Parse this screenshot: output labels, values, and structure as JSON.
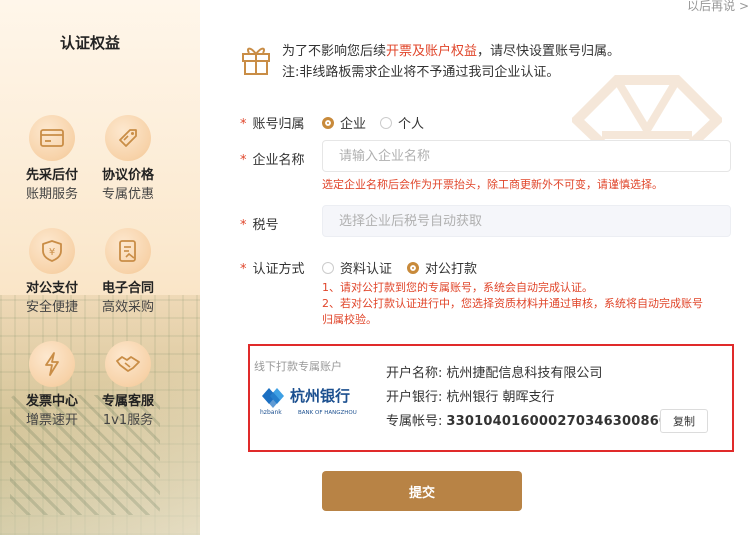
{
  "header": {
    "later_label": "以后再说 >"
  },
  "sidebar": {
    "title": "认证权益",
    "benefits": [
      {
        "title": "先采后付",
        "desc": "账期服务",
        "icon": "card-icon"
      },
      {
        "title": "协议价格",
        "desc": "专属优惠",
        "icon": "tag-icon"
      },
      {
        "title": "对公支付",
        "desc": "安全便捷",
        "icon": "shield-yuan-icon"
      },
      {
        "title": "电子合同",
        "desc": "高效采购",
        "icon": "contract-icon"
      },
      {
        "title": "发票中心",
        "desc": "增票速开",
        "icon": "lightning-icon"
      },
      {
        "title": "专属客服",
        "desc": "1v1服务",
        "icon": "handshake-icon"
      }
    ]
  },
  "notice": {
    "line1_prefix": "为了不影响您后续",
    "line1_highlight": "开票及账户权益",
    "line1_suffix": "，请尽快设置账号归属。",
    "line2": "注:非线路板需求企业将不予通过我司企业认证。"
  },
  "form": {
    "account_type": {
      "label": "账号归属",
      "options": [
        "企业",
        "个人"
      ],
      "selected": "企业"
    },
    "company_name": {
      "label": "企业名称",
      "placeholder": "请输入企业名称",
      "value": "",
      "warning": "选定企业名称后会作为开票抬头，除工商更新外不可变，请谨慎选择。"
    },
    "tax_number": {
      "label": "税号",
      "placeholder": "选择企业后税号自动获取"
    },
    "auth_method": {
      "label": "认证方式",
      "options": [
        "资料认证",
        "对公打款"
      ],
      "selected": "对公打款",
      "notes": [
        "1、请对公打款到您的专属账号，系统会自动完成认证。",
        "2、若对公打款认证进行中，您选择资质材料并通过审核，系统将自动完成账号",
        "归属校验。"
      ]
    }
  },
  "bank": {
    "tag": "线下打款专属账户",
    "logo_name": "杭州银行",
    "logo_sub_left": "hzbank",
    "logo_sub_right": "BANK OF HANGZHOU",
    "account_name_label": "开户名称:",
    "account_name": "杭州捷配信息科技有限公司",
    "bank_label": "开户银行:",
    "bank_name": "杭州银行 朝晖支行",
    "account_no_label": "专属帐号:",
    "account_no": "3301040160002703463008602",
    "copy_label": "复制"
  },
  "submit_label": "提交",
  "colors": {
    "accent": "#b88345",
    "required": "#e0452a",
    "highlight_border": "#e02a2a",
    "radio_selected": "#c88a3b"
  }
}
